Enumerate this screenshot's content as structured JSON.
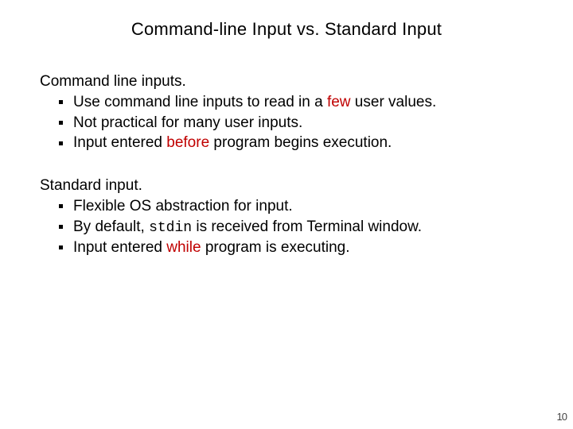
{
  "title": "Command-line Input vs. Standard Input",
  "sections": [
    {
      "heading": "Command line inputs.",
      "items": [
        {
          "pre": "Use command line inputs to read in a ",
          "accent": "few",
          "post": " user values."
        },
        {
          "pre": "Not practical for many user inputs.",
          "accent": "",
          "post": ""
        },
        {
          "pre": "Input entered ",
          "accent": "before",
          "post": " program begins execution."
        }
      ]
    },
    {
      "heading": "Standard input.",
      "items": [
        {
          "pre": "Flexible OS abstraction for input.",
          "accent": "",
          "post": ""
        },
        {
          "pre": "By default, ",
          "mono": "stdin",
          "post": " is received from Terminal window."
        },
        {
          "pre": "Input entered ",
          "accent": "while",
          "post": " program is executing."
        }
      ]
    }
  ],
  "page_number": "10"
}
